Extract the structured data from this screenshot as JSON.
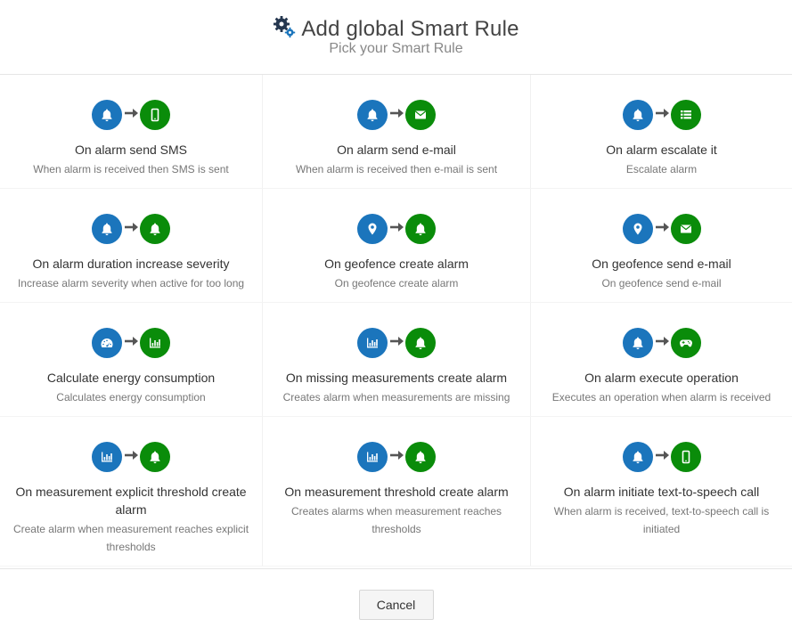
{
  "header": {
    "title": "Add global Smart Rule",
    "subtitle": "Pick your Smart Rule"
  },
  "colors": {
    "trigger_blue": "#1b75bc",
    "action_green": "#0a8c0a"
  },
  "rules": [
    {
      "title": "On alarm send SMS",
      "description": "When alarm is received then SMS is sent",
      "trigger_icon": "bell-icon",
      "action_icon": "mobile-icon"
    },
    {
      "title": "On alarm send e-mail",
      "description": "When alarm is received then e-mail is sent",
      "trigger_icon": "bell-icon",
      "action_icon": "envelope-icon"
    },
    {
      "title": "On alarm escalate it",
      "description": "Escalate alarm",
      "trigger_icon": "bell-icon",
      "action_icon": "list-icon"
    },
    {
      "title": "On alarm duration increase severity",
      "description": "Increase alarm severity when active for too long",
      "trigger_icon": "bell-icon",
      "action_icon": "bell-icon"
    },
    {
      "title": "On geofence create alarm",
      "description": "On geofence create alarm",
      "trigger_icon": "map-marker-icon",
      "action_icon": "bell-icon"
    },
    {
      "title": "On geofence send e-mail",
      "description": "On geofence send e-mail",
      "trigger_icon": "map-marker-icon",
      "action_icon": "envelope-icon"
    },
    {
      "title": "Calculate energy consumption",
      "description": "Calculates energy consumption",
      "trigger_icon": "dashboard-icon",
      "action_icon": "bar-chart-icon"
    },
    {
      "title": "On missing measurements create alarm",
      "description": "Creates alarm when measurements are missing",
      "trigger_icon": "bar-chart-icon",
      "action_icon": "bell-icon"
    },
    {
      "title": "On alarm execute operation",
      "description": "Executes an operation when alarm is received",
      "trigger_icon": "bell-icon",
      "action_icon": "gamepad-icon"
    },
    {
      "title": "On measurement explicit threshold create alarm",
      "description": "Create alarm when measurement reaches explicit thresholds",
      "trigger_icon": "bar-chart-icon",
      "action_icon": "bell-icon"
    },
    {
      "title": "On measurement threshold create alarm",
      "description": "Creates alarms when measurement reaches thresholds",
      "trigger_icon": "bar-chart-icon",
      "action_icon": "bell-icon"
    },
    {
      "title": "On alarm initiate text-to-speech call",
      "description": "When alarm is received, text-to-speech call is initiated",
      "trigger_icon": "bell-icon",
      "action_icon": "mobile-icon"
    }
  ],
  "footer": {
    "cancel_label": "Cancel"
  }
}
